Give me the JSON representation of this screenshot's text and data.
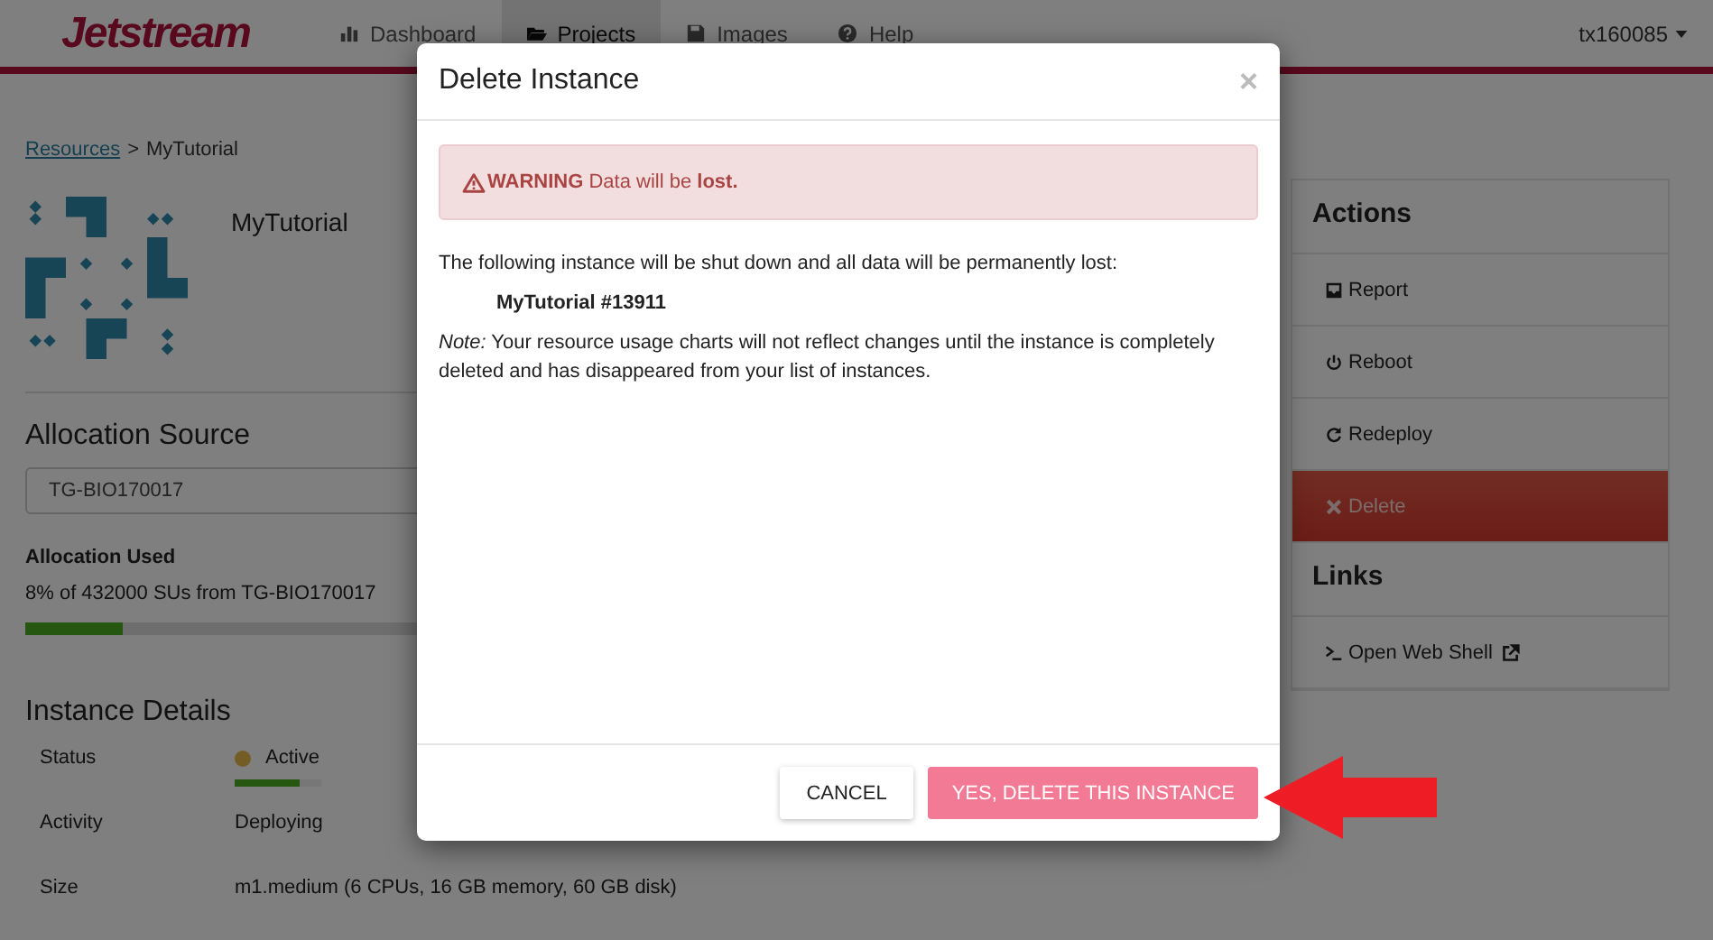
{
  "navbar": {
    "logo": "Jetstream",
    "items": [
      {
        "label": "Dashboard",
        "kind": "dashboard",
        "selected": false
      },
      {
        "label": "Projects",
        "kind": "projects",
        "selected": true
      },
      {
        "label": "Images",
        "kind": "images",
        "selected": false
      },
      {
        "label": "Help",
        "kind": "help",
        "selected": false
      }
    ],
    "user": "tx160085"
  },
  "breadcrumb": {
    "link": "Resources",
    "separator": ">",
    "current": "MyTutorial"
  },
  "instance": {
    "name": "MyTutorial"
  },
  "allocation_source": {
    "heading": "Allocation Source",
    "value": "TG-BIO170017",
    "used_label": "Allocation Used",
    "used_text": "8% of 432000 SUs from TG-BIO170017",
    "level": 0.08
  },
  "instance_details": {
    "heading": "Instance Details",
    "rows": [
      {
        "label": "Status",
        "value": "Active",
        "kind": "status",
        "level": 0.75
      },
      {
        "label": "Activity",
        "value": "Deploying",
        "kind": "text"
      },
      {
        "label": "Size",
        "value": "m1.medium (6 CPUs, 16 GB memory, 60 GB disk)",
        "kind": "text"
      }
    ]
  },
  "actions": {
    "heading": "Actions",
    "items": [
      {
        "label": "Report",
        "kind": "report"
      },
      {
        "label": "Reboot",
        "kind": "reboot"
      },
      {
        "label": "Redeploy",
        "kind": "redeploy"
      },
      {
        "label": "Delete",
        "kind": "delete"
      }
    ]
  },
  "links": {
    "heading": "Links",
    "items": [
      {
        "label": "Open Web Shell",
        "kind": "shell"
      }
    ]
  },
  "modal": {
    "title": "Delete Instance",
    "close": "×",
    "warning": "**WARNING** Data will be **lost.**",
    "message": "The following instance will be shut down and all data will be permanently lost:",
    "instance_name": "MyTutorial #13911",
    "note": "*Note:* Your resource usage charts will not reflect changes until the instance is completely deleted and has disappeared from your list of instances.",
    "cancel": "CANCEL",
    "confirm": "YES, DELETE THIS INSTANCE"
  }
}
